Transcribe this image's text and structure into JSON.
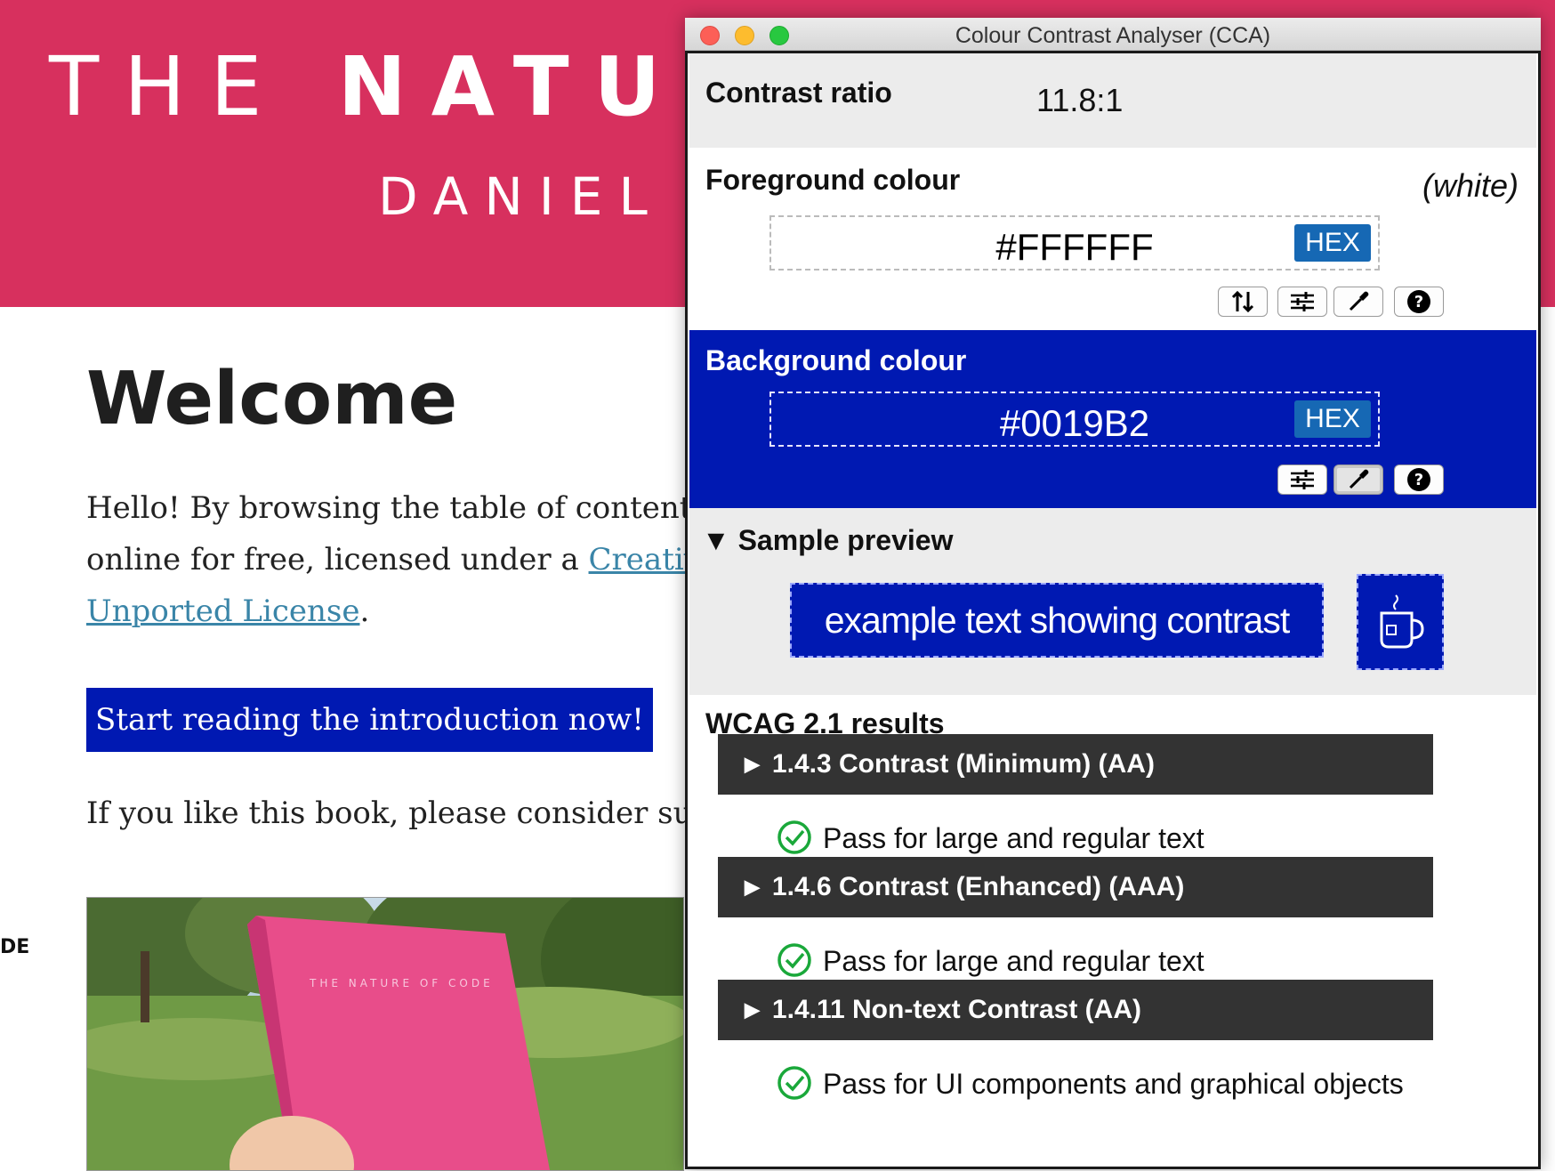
{
  "website": {
    "title_thin": "THE",
    "title_bold": "NATUR",
    "author": "DANIEL S",
    "heading": "Welcome",
    "intro_line1": "Hello! By browsing the table of content",
    "intro_line2": "online for free, licensed under a ",
    "intro_link": "Creativ",
    "intro_link2": "Unported License",
    "intro_end": ".",
    "cta_label": "Start reading the introduction now!",
    "support_text": "If you like this book, please consider su",
    "side_label": "DE",
    "colors": {
      "header": "#d7305e",
      "cta": "#0019b2",
      "link": "#3a85a8"
    }
  },
  "cca": {
    "window_title": "Colour Contrast Analyser (CCA)",
    "contrast_label": "Contrast ratio",
    "contrast_value": "11.8:1",
    "foreground": {
      "label": "Foreground colour",
      "name": "(white)",
      "value": "#FFFFFF",
      "format": "HEX",
      "tools": [
        "swap-icon",
        "sliders-icon",
        "eyedropper-icon",
        "help-icon"
      ]
    },
    "background": {
      "label": "Background colour",
      "value": "#0019B2",
      "format": "HEX",
      "tools": [
        "sliders-icon",
        "eyedropper-icon",
        "help-icon"
      ]
    },
    "sample": {
      "toggle_label": "Sample preview",
      "text": "example text showing contrast",
      "icon": "coffee-cup-icon"
    },
    "wcag": {
      "title": "WCAG 2.1 results",
      "criteria": [
        {
          "label": "1.4.3 Contrast (Minimum) (AA)",
          "result": "Pass for large and regular text"
        },
        {
          "label": "1.4.6 Contrast (Enhanced) (AAA)",
          "result": "Pass for large and regular text"
        },
        {
          "label": "1.4.11 Non-text Contrast (AA)",
          "result": "Pass for UI components and graphical objects"
        }
      ]
    },
    "colors": {
      "fg": "#ffffff",
      "bg": "#0019b2",
      "badge": "#1668b4",
      "criterion_bar": "#333333",
      "pass": "#1aa83a"
    }
  }
}
